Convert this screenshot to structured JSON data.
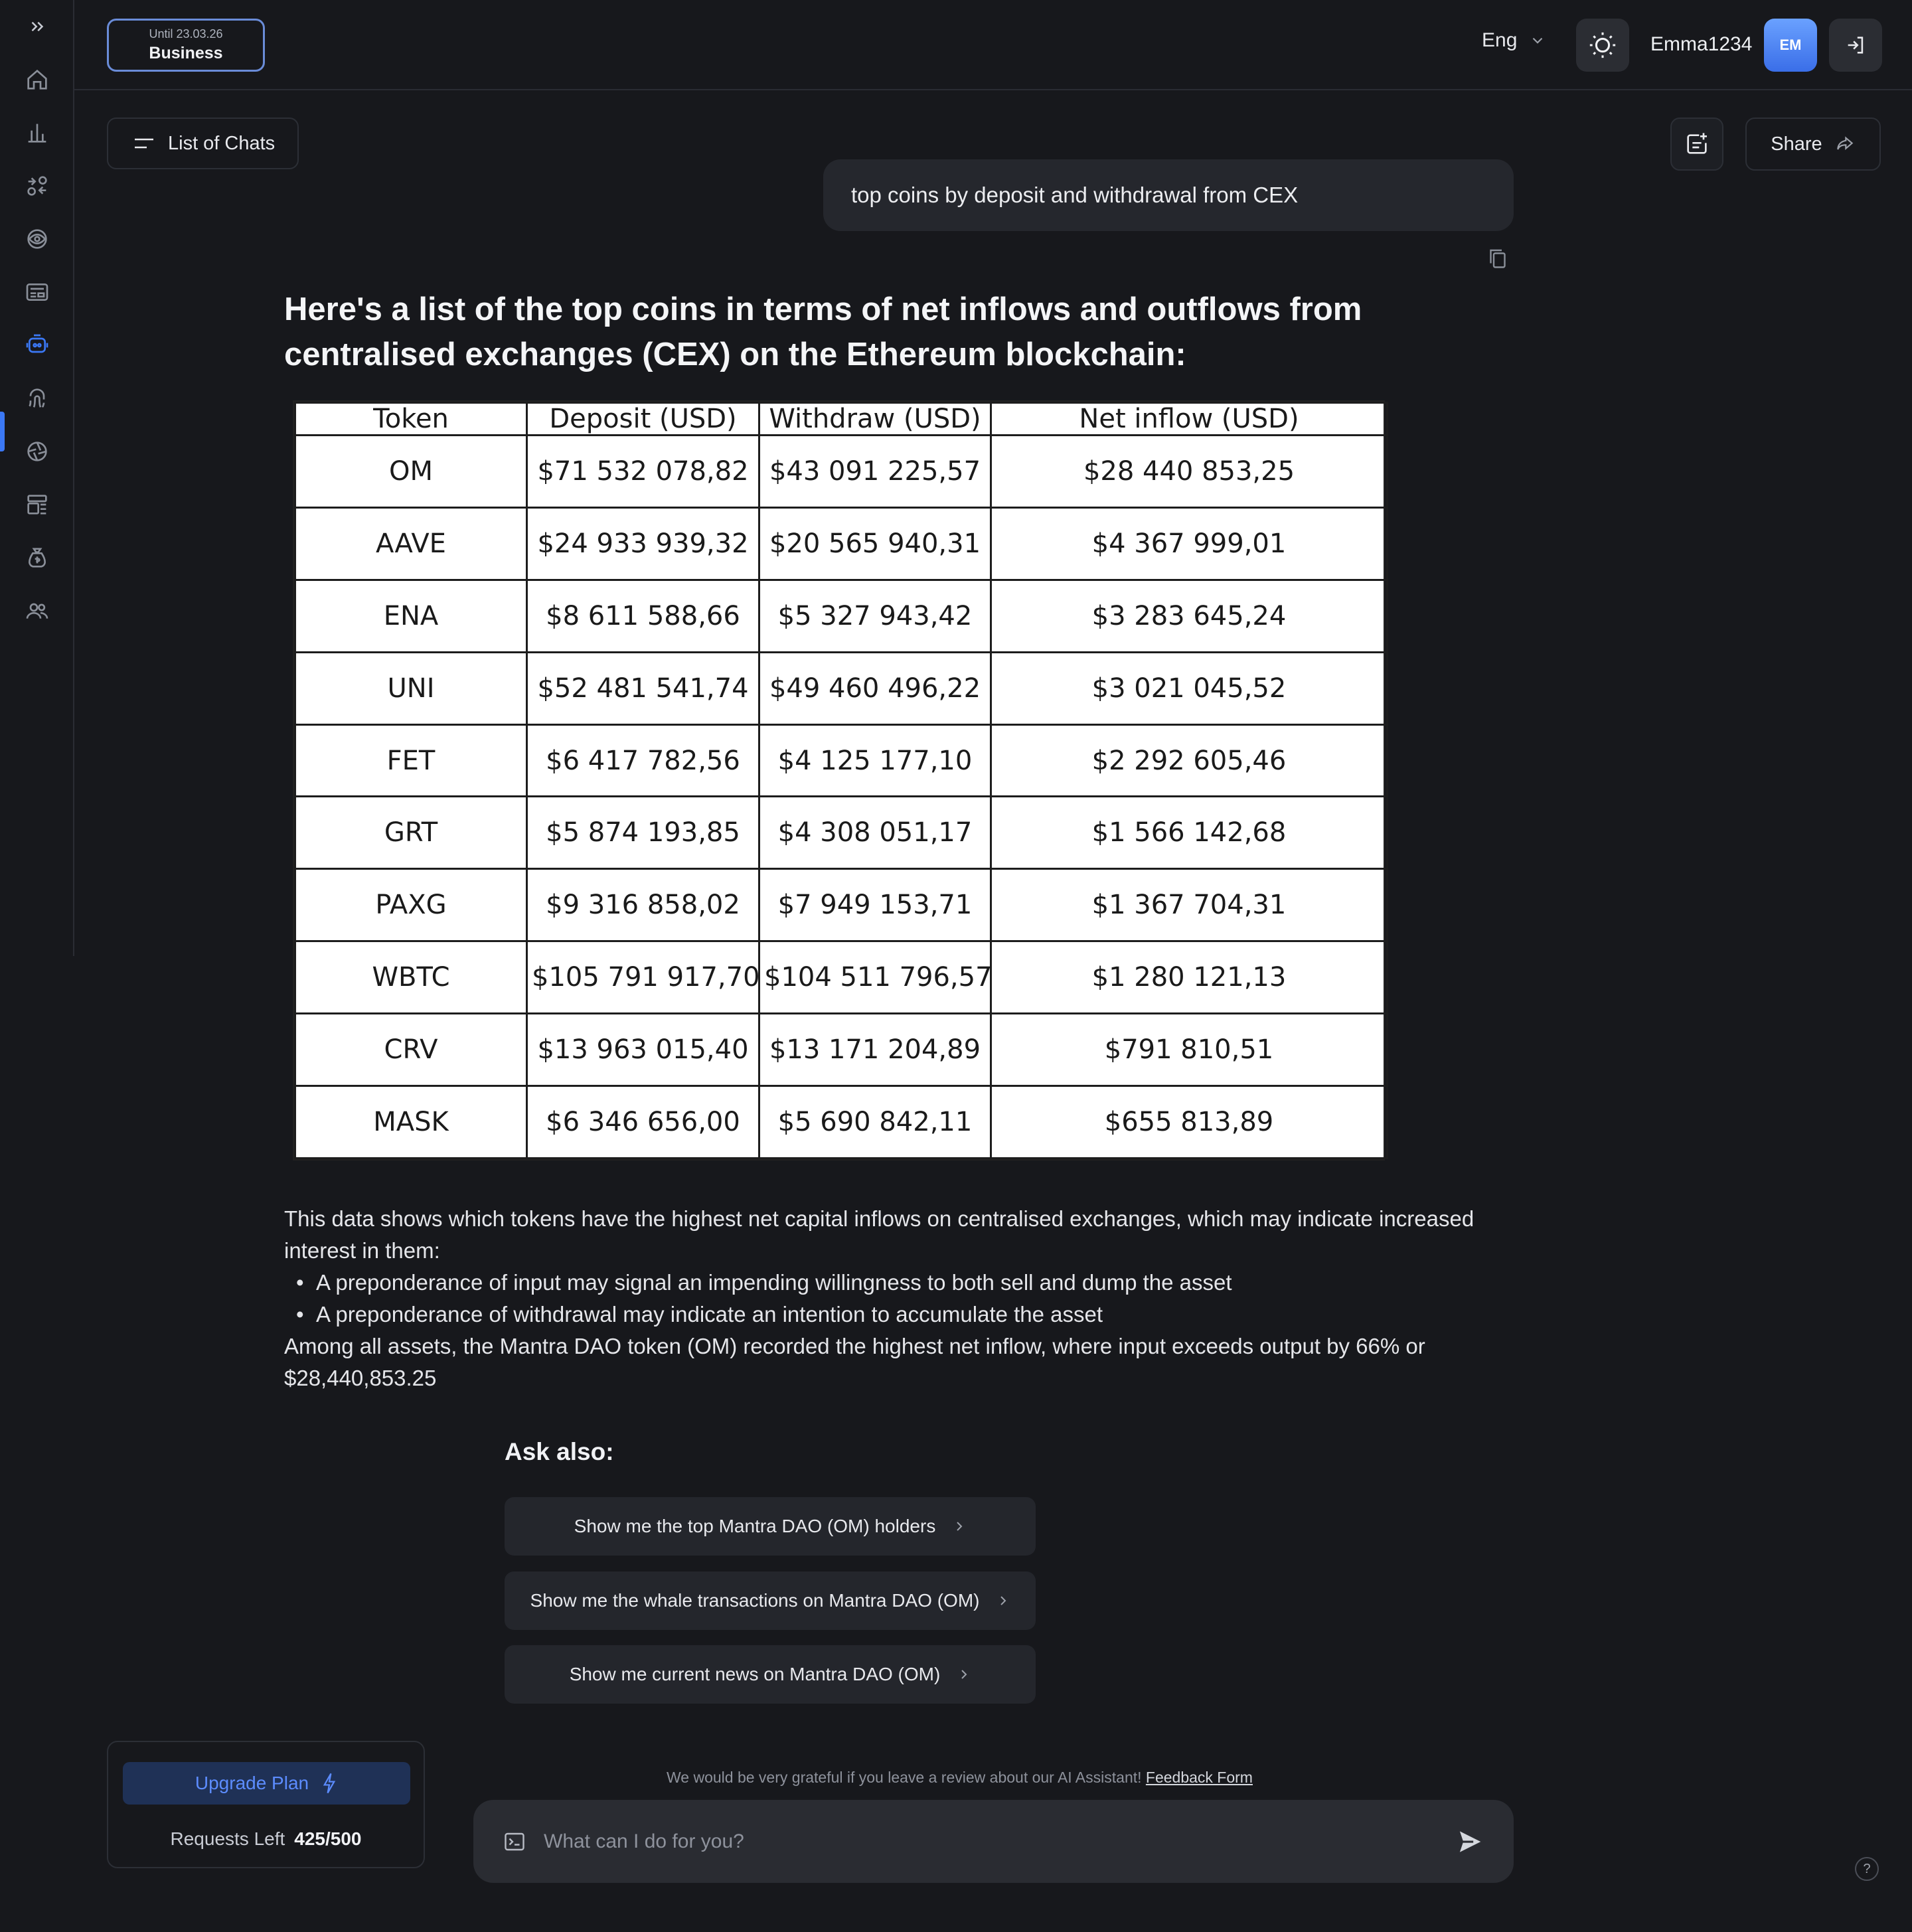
{
  "sidebar": {
    "expand_icon": "chevrons-right-icon",
    "items": [
      {
        "icon": "home-icon"
      },
      {
        "icon": "bar-chart-icon"
      },
      {
        "icon": "swap-icon"
      },
      {
        "icon": "eye-icon"
      },
      {
        "icon": "newspaper-icon"
      },
      {
        "icon": "robot-icon",
        "active": true
      },
      {
        "icon": "fingerprint-icon"
      },
      {
        "icon": "aperture-icon"
      },
      {
        "icon": "layout-icon"
      },
      {
        "icon": "money-bag-icon"
      },
      {
        "icon": "users-icon"
      }
    ]
  },
  "header": {
    "plan": {
      "until": "Until 23.03.26",
      "name": "Business"
    },
    "language": "Eng",
    "username": "Emma1234",
    "avatar_initials": "EM"
  },
  "toolbar": {
    "list_chats_label": "List of Chats",
    "share_label": "Share"
  },
  "conversation": {
    "user_message": "top coins by deposit and withdrawal from CEX",
    "answer_title": "Here's a list of the top coins in terms of net inflows and outflows from centralised exchanges (CEX) on the Ethereum blockchain:",
    "table": {
      "headers": [
        "Token",
        "Deposit (USD)",
        "Withdraw (USD)",
        "Net inflow (USD)"
      ],
      "rows": [
        [
          "OM",
          "$71 532 078,82",
          "$43 091 225,57",
          "$28 440 853,25"
        ],
        [
          "AAVE",
          "$24 933 939,32",
          "$20 565 940,31",
          "$4 367 999,01"
        ],
        [
          "ENA",
          "$8 611 588,66",
          "$5 327 943,42",
          "$3 283 645,24"
        ],
        [
          "UNI",
          "$52 481 541,74",
          "$49 460 496,22",
          "$3 021 045,52"
        ],
        [
          "FET",
          "$6 417 782,56",
          "$4 125 177,10",
          "$2 292 605,46"
        ],
        [
          "GRT",
          "$5 874 193,85",
          "$4 308 051,17",
          "$1 566 142,68"
        ],
        [
          "PAXG",
          "$9 316 858,02",
          "$7 949 153,71",
          "$1 367 704,31"
        ],
        [
          "WBTC",
          "$105 791 917,70",
          "$104 511 796,57",
          "$1 280 121,13"
        ],
        [
          "CRV",
          "$13 963 015,40",
          "$13 171 204,89",
          "$791 810,51"
        ],
        [
          "MASK",
          "$6 346 656,00",
          "$5 690 842,11",
          "$655 813,89"
        ]
      ]
    },
    "paragraph_1": "This data shows which tokens have the highest net capital inflows on centralised exchanges, which may indicate increased interest in them:",
    "bullets": [
      "A preponderance of input may signal an impending willingness to both sell and dump the asset",
      "A preponderance of withdrawal may indicate an intention to accumulate the asset"
    ],
    "paragraph_2": "Among all assets, the Mantra DAO token (OM) recorded the highest net inflow, where input exceeds output by 66% or $28,440,853.25"
  },
  "ask_also": {
    "title": "Ask also:",
    "suggestions": [
      "Show me the top Mantra DAO (OM) holders",
      "Show me the whale transactions on Mantra DAO (OM)",
      "Show me current news on Mantra DAO (OM)"
    ]
  },
  "plan_box": {
    "upgrade_label": "Upgrade Plan",
    "requests_label": "Requests Left",
    "requests_value": "425/500"
  },
  "composer": {
    "feedback_text": "We would be very grateful if you leave a review about our AI Assistant!",
    "feedback_link": "Feedback Form",
    "placeholder": "What can I do for you?"
  },
  "help_label": "?",
  "colors": {
    "background": "#17181c",
    "accent": "#3b78f5",
    "upgrade_bg": "#1f3156",
    "upgrade_text": "#5c8cff"
  }
}
